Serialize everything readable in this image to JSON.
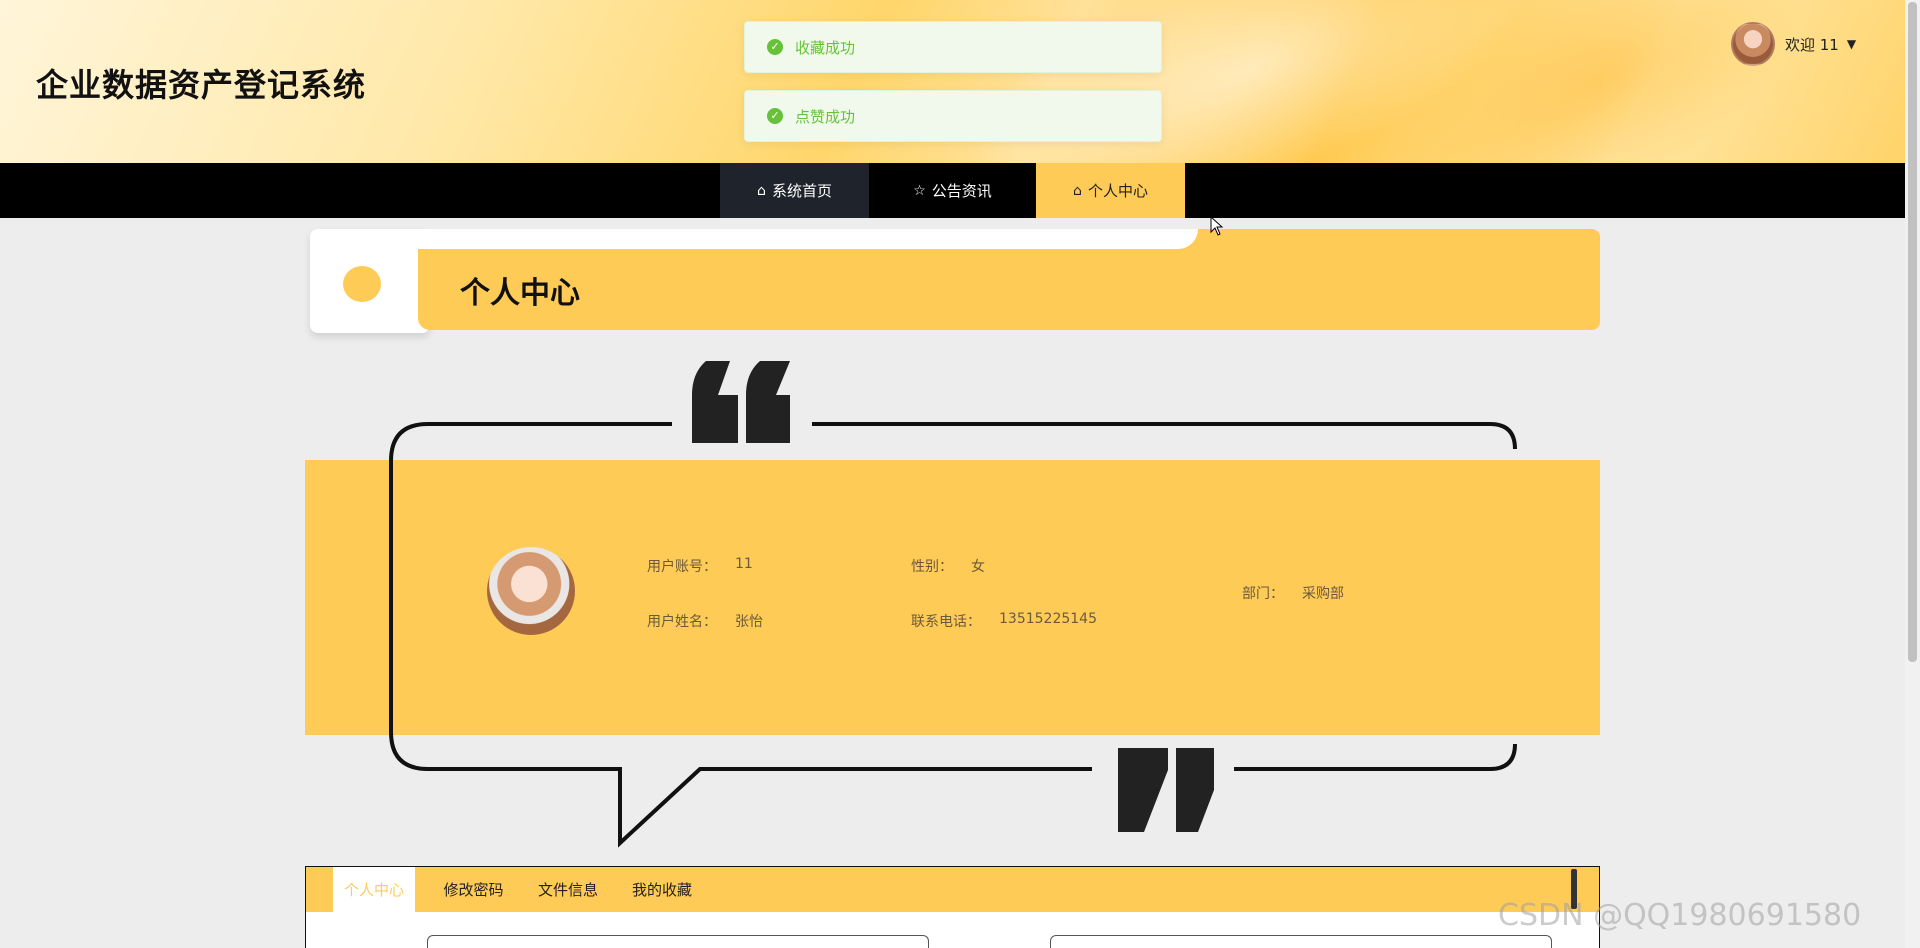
{
  "header": {
    "title": "企业数据资产登记系统",
    "welcome": "欢迎 11",
    "caret": "▼"
  },
  "toasts": [
    {
      "message": "收藏成功"
    },
    {
      "message": "点赞成功"
    }
  ],
  "nav": {
    "items": [
      {
        "label": "系统首页",
        "icon": "home-icon"
      },
      {
        "label": "公告资讯",
        "icon": "star-icon"
      },
      {
        "label": "个人中心",
        "icon": "home-icon"
      }
    ]
  },
  "section": {
    "title": "个人中心"
  },
  "profile": {
    "account_label": "用户账号：",
    "account_value": "11",
    "name_label": "用户姓名：",
    "name_value": "张怡",
    "gender_label": "性别：",
    "gender_value": "女",
    "phone_label": "联系电话：",
    "phone_value": "13515225145",
    "dept_label": "部门：",
    "dept_value": "采购部"
  },
  "tabs": [
    {
      "label": "个人中心"
    },
    {
      "label": "修改密码"
    },
    {
      "label": "文件信息"
    },
    {
      "label": "我的收藏"
    }
  ],
  "watermark": "CSDN @QQ1980691580",
  "colors": {
    "accent": "#ffcb57",
    "nav_bg": "#000000",
    "success": "#67c23a"
  }
}
